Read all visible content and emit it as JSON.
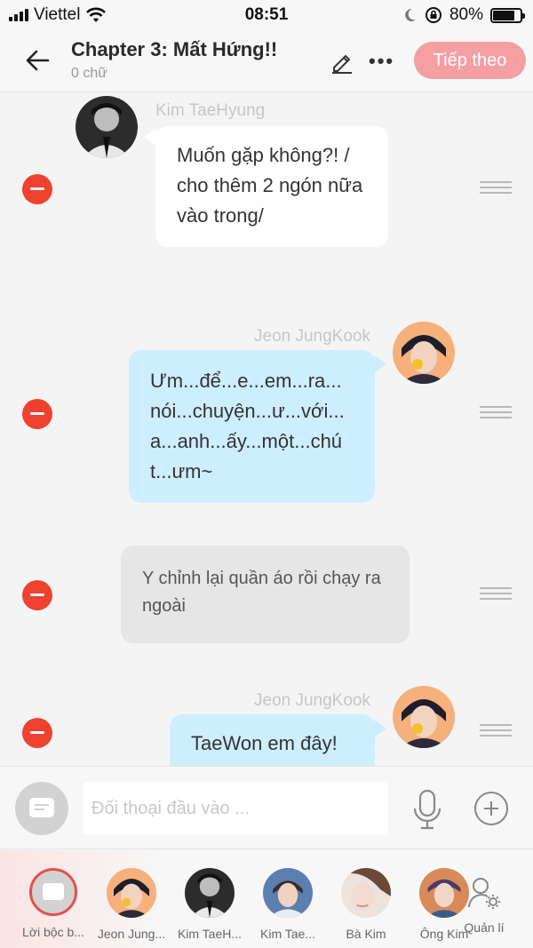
{
  "status_bar": {
    "carrier": "Viettel",
    "time": "08:51",
    "battery": "80%",
    "battery_level": 0.8
  },
  "header": {
    "title": "Chapter 3: Mất Hứng!!",
    "word_count": "0 chữ",
    "next_label": "Tiếp theo"
  },
  "messages": [
    {
      "speaker": "Kim TaeHyung",
      "text": "Muốn gặp không?! / cho thêm 2 ngón nữa vào trong/"
    },
    {
      "speaker": "Jeon JungKook",
      "text": "Ưm...để...e...em...ra... nói...chuyện...ư...với... a...anh...ấy...một...chú t...ưm~"
    },
    {
      "text": "Y chỉnh lại quần áo rồi chạy ra ngoài"
    },
    {
      "speaker": "Jeon JungKook",
      "text": "TaeWon em đây!"
    }
  ],
  "input": {
    "placeholder": "Đối thoại đầu vào ..."
  },
  "characters": [
    {
      "name": "Lời bộc b..."
    },
    {
      "name": "Jeon Jung..."
    },
    {
      "name": "Kim TaeH..."
    },
    {
      "name": "Kim Tae..."
    },
    {
      "name": "Bà Kim"
    },
    {
      "name": "Ông Kim"
    }
  ],
  "manage_label": "Quản lí",
  "colors": {
    "accent": "#f59fa3",
    "remove": "#f0412f",
    "bubble_right": "#cdeeff",
    "narration": "#e6e6e6"
  }
}
